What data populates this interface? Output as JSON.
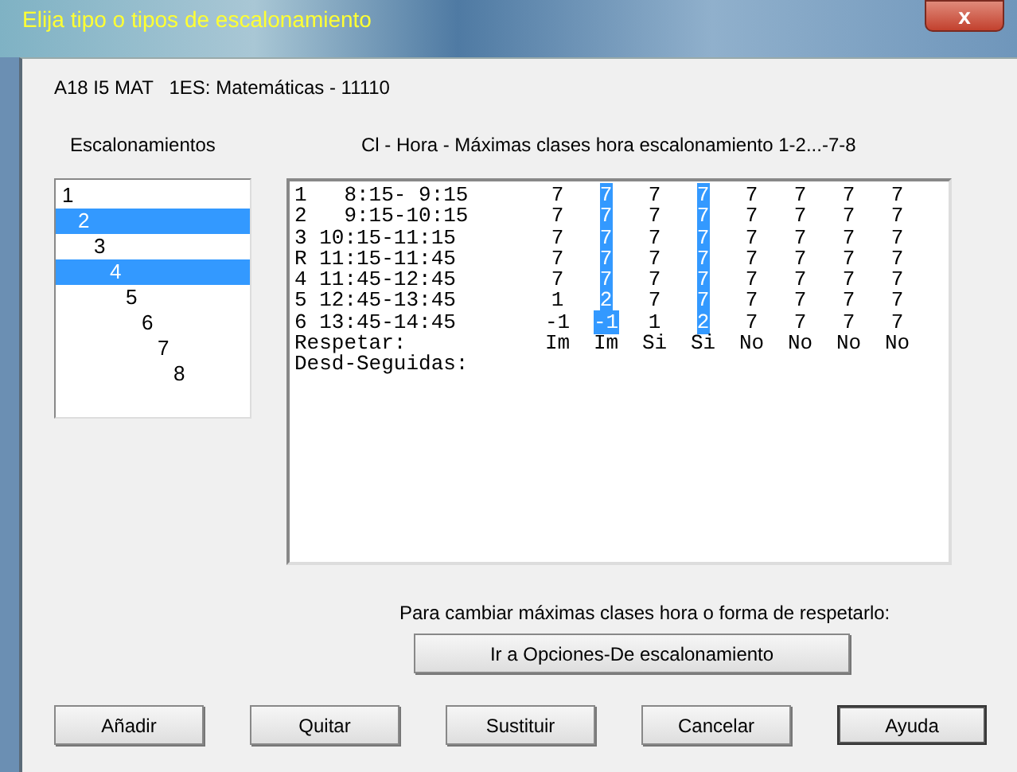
{
  "window": {
    "title": "Elija tipo o tipos de escalonamiento",
    "close": "x"
  },
  "subject": "A18 I5 MAT   1ES: Matemáticas - 11110",
  "list_heading": "Escalonamientos",
  "table_heading": "Cl - Hora - Máximas clases hora escalonamiento 1-2...-7-8",
  "escalonamientos": [
    {
      "label": "1",
      "selected": false
    },
    {
      "label": "2",
      "selected": true
    },
    {
      "label": "3",
      "selected": false
    },
    {
      "label": "4",
      "selected": true
    },
    {
      "label": "5",
      "selected": false
    },
    {
      "label": "6",
      "selected": false
    },
    {
      "label": "7",
      "selected": false
    },
    {
      "label": "8",
      "selected": false
    }
  ],
  "rows": [
    {
      "label": "1   8:15- 9:15",
      "cells": [
        {
          "text": "7",
          "selected": false
        },
        {
          "text": "7",
          "selected": true
        },
        {
          "text": "7",
          "selected": false
        },
        {
          "text": "7",
          "selected": true
        },
        {
          "text": "7",
          "selected": false
        },
        {
          "text": "7",
          "selected": false
        },
        {
          "text": "7",
          "selected": false
        },
        {
          "text": "7",
          "selected": false
        }
      ]
    },
    {
      "label": "2   9:15-10:15",
      "cells": [
        {
          "text": "7",
          "selected": false
        },
        {
          "text": "7",
          "selected": true
        },
        {
          "text": "7",
          "selected": false
        },
        {
          "text": "7",
          "selected": true
        },
        {
          "text": "7",
          "selected": false
        },
        {
          "text": "7",
          "selected": false
        },
        {
          "text": "7",
          "selected": false
        },
        {
          "text": "7",
          "selected": false
        }
      ]
    },
    {
      "label": "3 10:15-11:15",
      "cells": [
        {
          "text": "7",
          "selected": false
        },
        {
          "text": "7",
          "selected": true
        },
        {
          "text": "7",
          "selected": false
        },
        {
          "text": "7",
          "selected": true
        },
        {
          "text": "7",
          "selected": false
        },
        {
          "text": "7",
          "selected": false
        },
        {
          "text": "7",
          "selected": false
        },
        {
          "text": "7",
          "selected": false
        }
      ]
    },
    {
      "label": "R 11:15-11:45",
      "cells": [
        {
          "text": "7",
          "selected": false
        },
        {
          "text": "7",
          "selected": true
        },
        {
          "text": "7",
          "selected": false
        },
        {
          "text": "7",
          "selected": true
        },
        {
          "text": "7",
          "selected": false
        },
        {
          "text": "7",
          "selected": false
        },
        {
          "text": "7",
          "selected": false
        },
        {
          "text": "7",
          "selected": false
        }
      ]
    },
    {
      "label": "4 11:45-12:45",
      "cells": [
        {
          "text": "7",
          "selected": false
        },
        {
          "text": "7",
          "selected": true
        },
        {
          "text": "7",
          "selected": false
        },
        {
          "text": "7",
          "selected": true
        },
        {
          "text": "7",
          "selected": false
        },
        {
          "text": "7",
          "selected": false
        },
        {
          "text": "7",
          "selected": false
        },
        {
          "text": "7",
          "selected": false
        }
      ]
    },
    {
      "label": "5 12:45-13:45",
      "cells": [
        {
          "text": "1",
          "selected": false
        },
        {
          "text": "2",
          "selected": true
        },
        {
          "text": "7",
          "selected": false
        },
        {
          "text": "7",
          "selected": true
        },
        {
          "text": "7",
          "selected": false
        },
        {
          "text": "7",
          "selected": false
        },
        {
          "text": "7",
          "selected": false
        },
        {
          "text": "7",
          "selected": false
        }
      ]
    },
    {
      "label": "6 13:45-14:45",
      "cells": [
        {
          "text": "-1",
          "selected": false
        },
        {
          "text": "-1",
          "selected": true
        },
        {
          "text": "1",
          "selected": false
        },
        {
          "text": "2",
          "selected": true
        },
        {
          "text": "7",
          "selected": false
        },
        {
          "text": "7",
          "selected": false
        },
        {
          "text": "7",
          "selected": false
        },
        {
          "text": "7",
          "selected": false
        }
      ]
    },
    {
      "label": "Respetar:",
      "cells": [
        {
          "text": "Im",
          "selected": false
        },
        {
          "text": "Im",
          "selected": false
        },
        {
          "text": "Si",
          "selected": false
        },
        {
          "text": "Si",
          "selected": false
        },
        {
          "text": "No",
          "selected": false
        },
        {
          "text": "No",
          "selected": false
        },
        {
          "text": "No",
          "selected": false
        },
        {
          "text": "No",
          "selected": false
        }
      ]
    },
    {
      "label": "Desd-Seguidas:",
      "cells": []
    }
  ],
  "hint": "Para cambiar máximas clases hora o forma de respetarlo:",
  "options_button": "Ir a Opciones-De escalonamiento",
  "buttons": [
    {
      "label": "Añadir",
      "default": false
    },
    {
      "label": "Quitar",
      "default": false
    },
    {
      "label": "Sustituir",
      "default": false
    },
    {
      "label": "Cancelar",
      "default": false
    },
    {
      "label": "Ayuda",
      "default": true
    }
  ]
}
